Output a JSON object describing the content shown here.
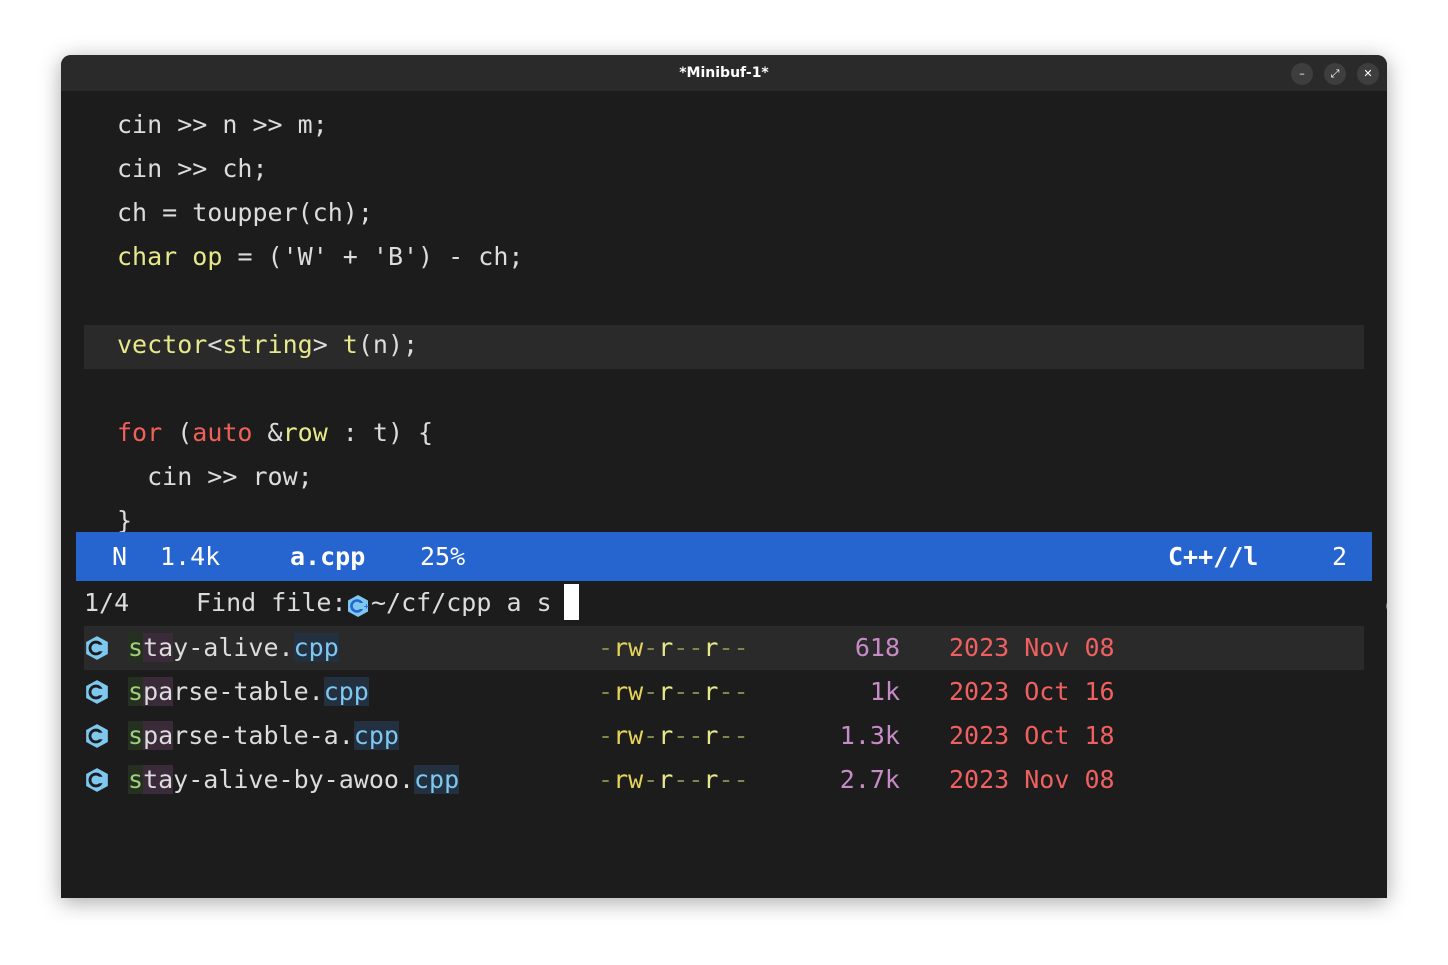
{
  "window": {
    "title": "*Minibuf-1*",
    "controls": {
      "minimize": "–",
      "maximize": "⤢",
      "close": "✕"
    }
  },
  "code": {
    "lines": [
      "cin >> n >> m;",
      "cin >> ch;",
      "ch = toupper(ch);",
      {
        "kw_char": "char",
        "var_op": "op",
        "rest": " = ('W' + 'B') - ch;"
      },
      "",
      {
        "kw_vector": "vector",
        "lt": "<",
        "kw_string": "string",
        "gt": "> ",
        "fn_t": "t",
        "rest": "(n);"
      },
      "",
      {
        "kw_for": "for",
        "p1": " (",
        "kw_auto": "auto",
        "amp": " &",
        "var_row": "row",
        "rest": " : t) {"
      },
      "  cin >> row;",
      "}"
    ]
  },
  "modeline": {
    "state": "N",
    "size": "1.4k",
    "buffer": "a.cpp",
    "position": "25%",
    "mode": "C++//l",
    "warnings": "2",
    "bg": "#2664cf"
  },
  "minibuffer": {
    "count": "1/4",
    "prompt": "Find file: ",
    "input": "~/cf/cpp a s"
  },
  "candidates": [
    {
      "m1": "s",
      "m2": "ta",
      "name": "y-alive.",
      "ext": "cpp",
      "dash0": "-",
      "rw": "rw",
      "dash1": "-",
      "r1": "r",
      "dash2": "--",
      "r2": "r",
      "dash3": "--",
      "size": "618",
      "date": "2023 Nov 08"
    },
    {
      "m1": "s",
      "m2": "pa",
      "name": "rse-table.",
      "ext": "cpp",
      "dash0": "-",
      "rw": "rw",
      "dash1": "-",
      "r1": "r",
      "dash2": "--",
      "r2": "r",
      "dash3": "--",
      "size": "1k",
      "date": "2023 Oct 16"
    },
    {
      "m1": "s",
      "m2": "pa",
      "name": "rse-table-a.",
      "ext": "cpp",
      "dash0": "-",
      "rw": "rw",
      "dash1": "-",
      "r1": "r",
      "dash2": "--",
      "r2": "r",
      "dash3": "--",
      "size": "1.3k",
      "date": "2023 Oct 18"
    },
    {
      "m1": "s",
      "m2": "ta",
      "name": "y-alive-by-awoo.",
      "ext": "cpp",
      "dash0": "-",
      "rw": "rw",
      "dash1": "-",
      "r1": "r",
      "dash2": "--",
      "r2": "r",
      "dash3": "--",
      "size": "2.7k",
      "date": "2023 Nov 08"
    }
  ],
  "icons": {
    "file": "cplusplus-icon",
    "warning": "warning-circle-icon"
  },
  "colors": {
    "accent": "#2664cf",
    "keyword": "#f0605a",
    "type": "#e6e88a",
    "size": "#c78cc8",
    "date": "#f06060",
    "ext": "#7ec8f0"
  }
}
